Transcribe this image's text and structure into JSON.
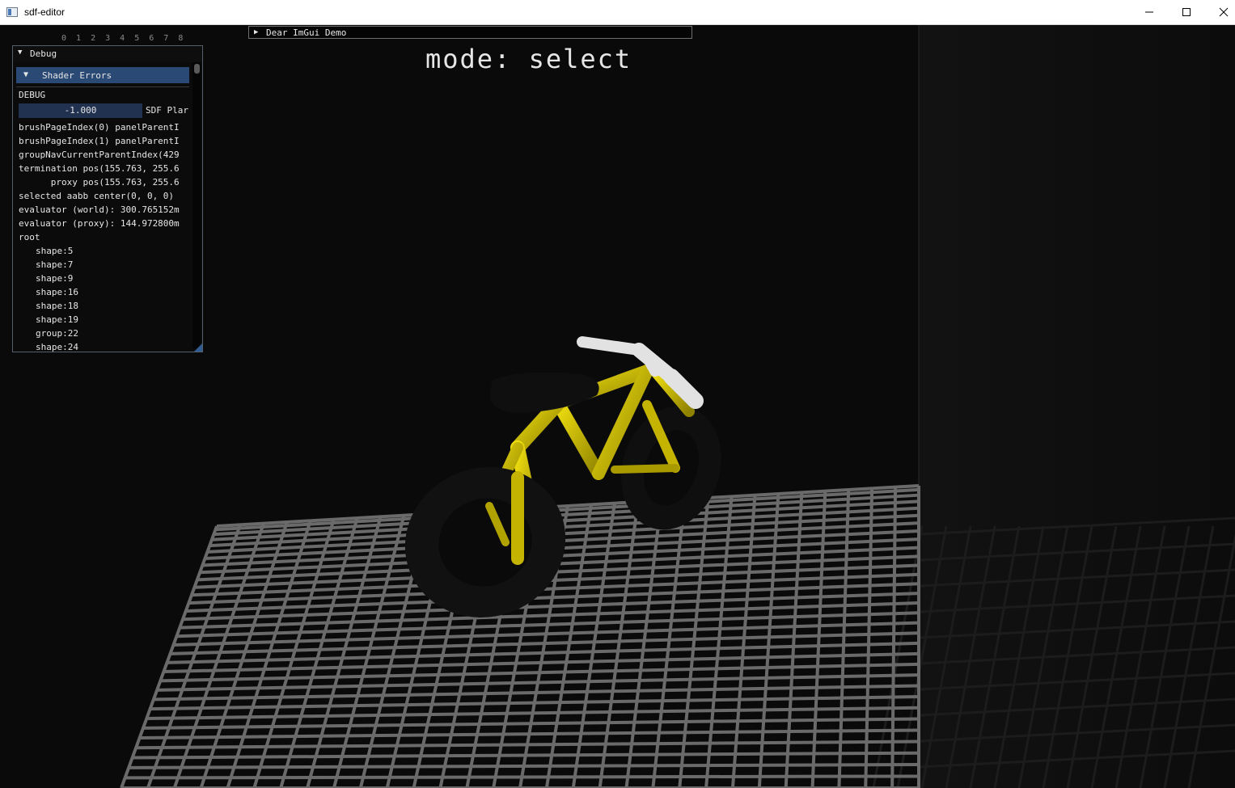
{
  "window": {
    "title": "sdf-editor"
  },
  "tab_numbers": "0 1 2 3 4 5 6 7 8",
  "demo_window": {
    "title": "Dear ImGui Demo"
  },
  "mode_label": "mode: select",
  "debug_panel": {
    "title": "Debug",
    "shader_errors": "Shader Errors",
    "section": "DEBUG",
    "slider_value": "-1.000",
    "slider_label": "SDF Plar",
    "lines": [
      "brushPageIndex(0) panelParentI",
      "brushPageIndex(1) panelParentI",
      "groupNavCurrentParentIndex(429",
      "termination pos(155.763, 255.6",
      "      proxy pos(155.763, 255.6",
      "selected aabb center(0, 0, 0)",
      "evaluator (world): 300.765152m",
      "evaluator (proxy): 144.972800m",
      "root"
    ],
    "tree": [
      "shape:5",
      "shape:7",
      "shape:9",
      "shape:16",
      "shape:18",
      "shape:19",
      "group:22",
      "shape:24"
    ]
  },
  "scene": {
    "frame_color": "#d7c400",
    "tire_color": "#121212",
    "handlebar_color": "#e0e0e0",
    "grid_color": "#6a6a6a"
  }
}
